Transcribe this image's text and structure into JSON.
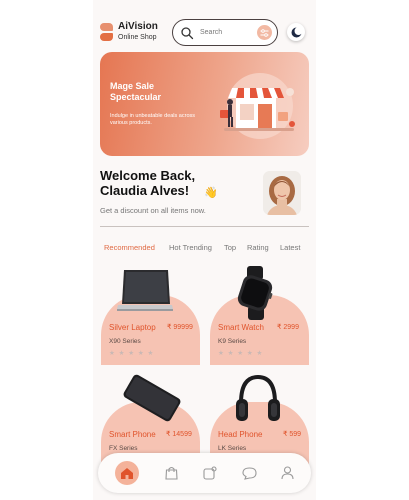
{
  "app": {
    "name": "AiVision",
    "subtitle": "Online Shop"
  },
  "search": {
    "placeholder": "Search"
  },
  "icons": {
    "logo": "logo-icon",
    "search": "search-icon",
    "filter": "filter-icon",
    "theme": "moon-icon",
    "home": "home-icon",
    "bag": "shopping-bag-icon",
    "notes": "notification-icon",
    "chat": "chat-icon",
    "profile": "profile-icon",
    "wave": "waving-hand-icon"
  },
  "banner": {
    "title": "Mage Sale Spectacular",
    "subtitle": "Indulge in unbeatable deals across various products."
  },
  "welcome": {
    "line1": "Welcome Back,",
    "line2": "Claudia Alves!",
    "emoji": "👋",
    "subtitle": "Get a discount on all items now."
  },
  "tabs": [
    "Recommended",
    "Hot Trending",
    "Top",
    "Rating",
    "Latest"
  ],
  "active_tab": "Recommended",
  "products": [
    {
      "name": "Silver Laptop",
      "price": "₹ 99999",
      "series": "X90 Series",
      "rating_stars": 5,
      "image": "laptop"
    },
    {
      "name": "Smart Watch",
      "price": "₹ 2999",
      "series": "K9 Series",
      "rating_stars": 5,
      "image": "smartwatch"
    },
    {
      "name": "Smart Phone",
      "price": "₹ 14599",
      "series": "FX Series",
      "image": "smartphone"
    },
    {
      "name": "Head Phone",
      "price": "₹ 599",
      "series": "LK Series",
      "image": "headphones"
    }
  ],
  "stars": "★ ★ ★ ★ ★",
  "colors": {
    "accent": "#e36f44",
    "card": "#f6c3b3",
    "banner_start": "#e57652",
    "banner_end": "#f6cdc0"
  }
}
